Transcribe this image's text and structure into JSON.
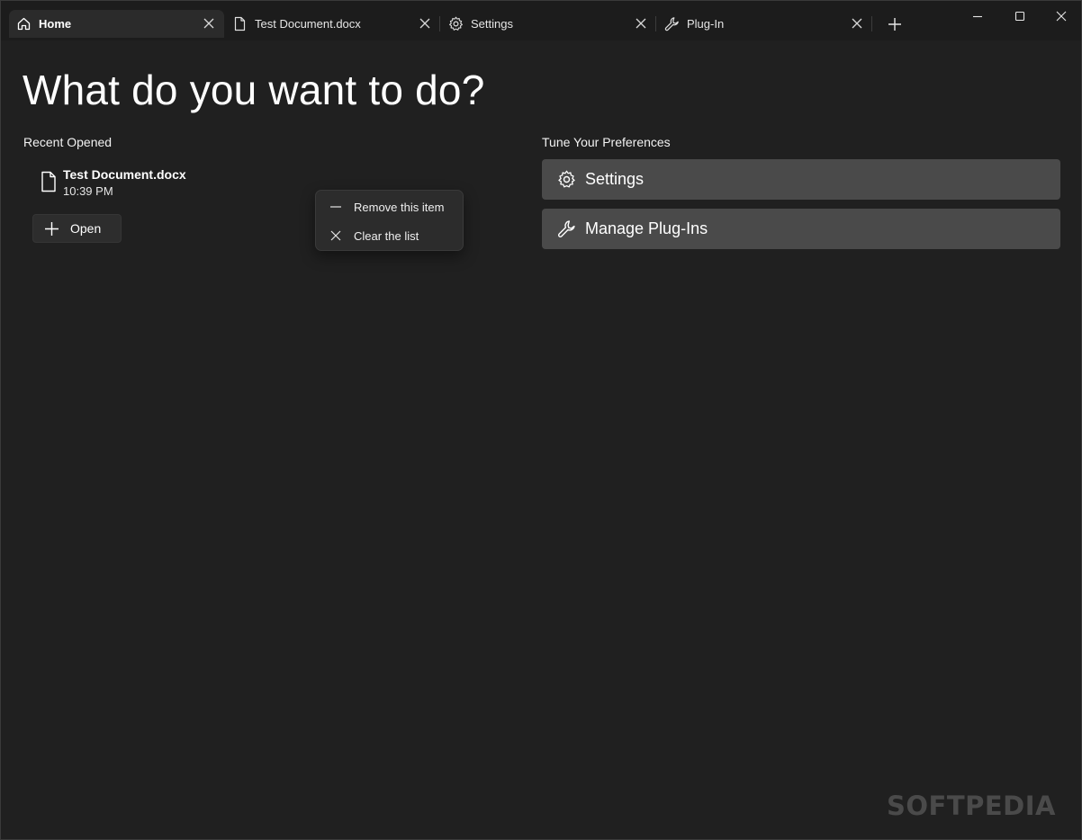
{
  "tabs": [
    {
      "label": "Home",
      "icon": "home-icon",
      "active": true
    },
    {
      "label": "Test Document.docx",
      "icon": "document-icon",
      "active": false
    },
    {
      "label": "Settings",
      "icon": "gear-icon",
      "active": false
    },
    {
      "label": "Plug-In",
      "icon": "wrench-icon",
      "active": false
    }
  ],
  "main": {
    "title": "What do you want to do?",
    "recent": {
      "label": "Recent Opened",
      "items": [
        {
          "name": "Test Document.docx",
          "time": "10:39 PM"
        }
      ],
      "open_label": "Open"
    },
    "preferences": {
      "label": "Tune Your Preferences",
      "settings_label": "Settings",
      "plugins_label": "Manage Plug-Ins"
    }
  },
  "context_menu": {
    "items": [
      {
        "label": "Remove this item",
        "icon": "minus-icon"
      },
      {
        "label": "Clear the list",
        "icon": "close-icon"
      }
    ]
  },
  "watermark": "SOFTPEDIA",
  "colors": {
    "background": "#202020",
    "tabbar": "#1c1c1c",
    "active_tab": "#2b2b2b",
    "pref_button": "#4a4a4a",
    "menu": "#2c2c2c"
  }
}
